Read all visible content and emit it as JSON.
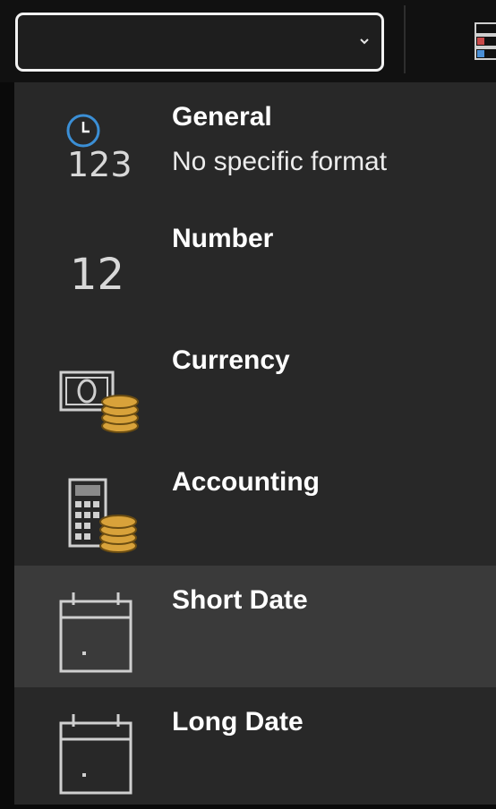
{
  "number_format_box": {
    "value": "",
    "arrow_icon": "chevron-down-icon"
  },
  "menu": {
    "items": [
      {
        "title": "General",
        "description": "No specific format",
        "icon": "clock-123-icon",
        "icon_text": "123"
      },
      {
        "title": "Number",
        "description": "",
        "icon": "number-12-icon",
        "icon_text": "12"
      },
      {
        "title": "Currency",
        "description": "",
        "icon": "currency-icon"
      },
      {
        "title": "Accounting",
        "description": "",
        "icon": "accounting-icon"
      },
      {
        "title": "Short Date",
        "description": "",
        "icon": "calendar-icon",
        "highlighted": true
      },
      {
        "title": "Long Date",
        "description": "",
        "icon": "calendar-icon"
      }
    ]
  },
  "colors": {
    "menu_bg": "#282828",
    "highlight_bg": "#3a3a3a",
    "accent_blue": "#3b8fd6",
    "coin_gold": "#d8a23a"
  }
}
